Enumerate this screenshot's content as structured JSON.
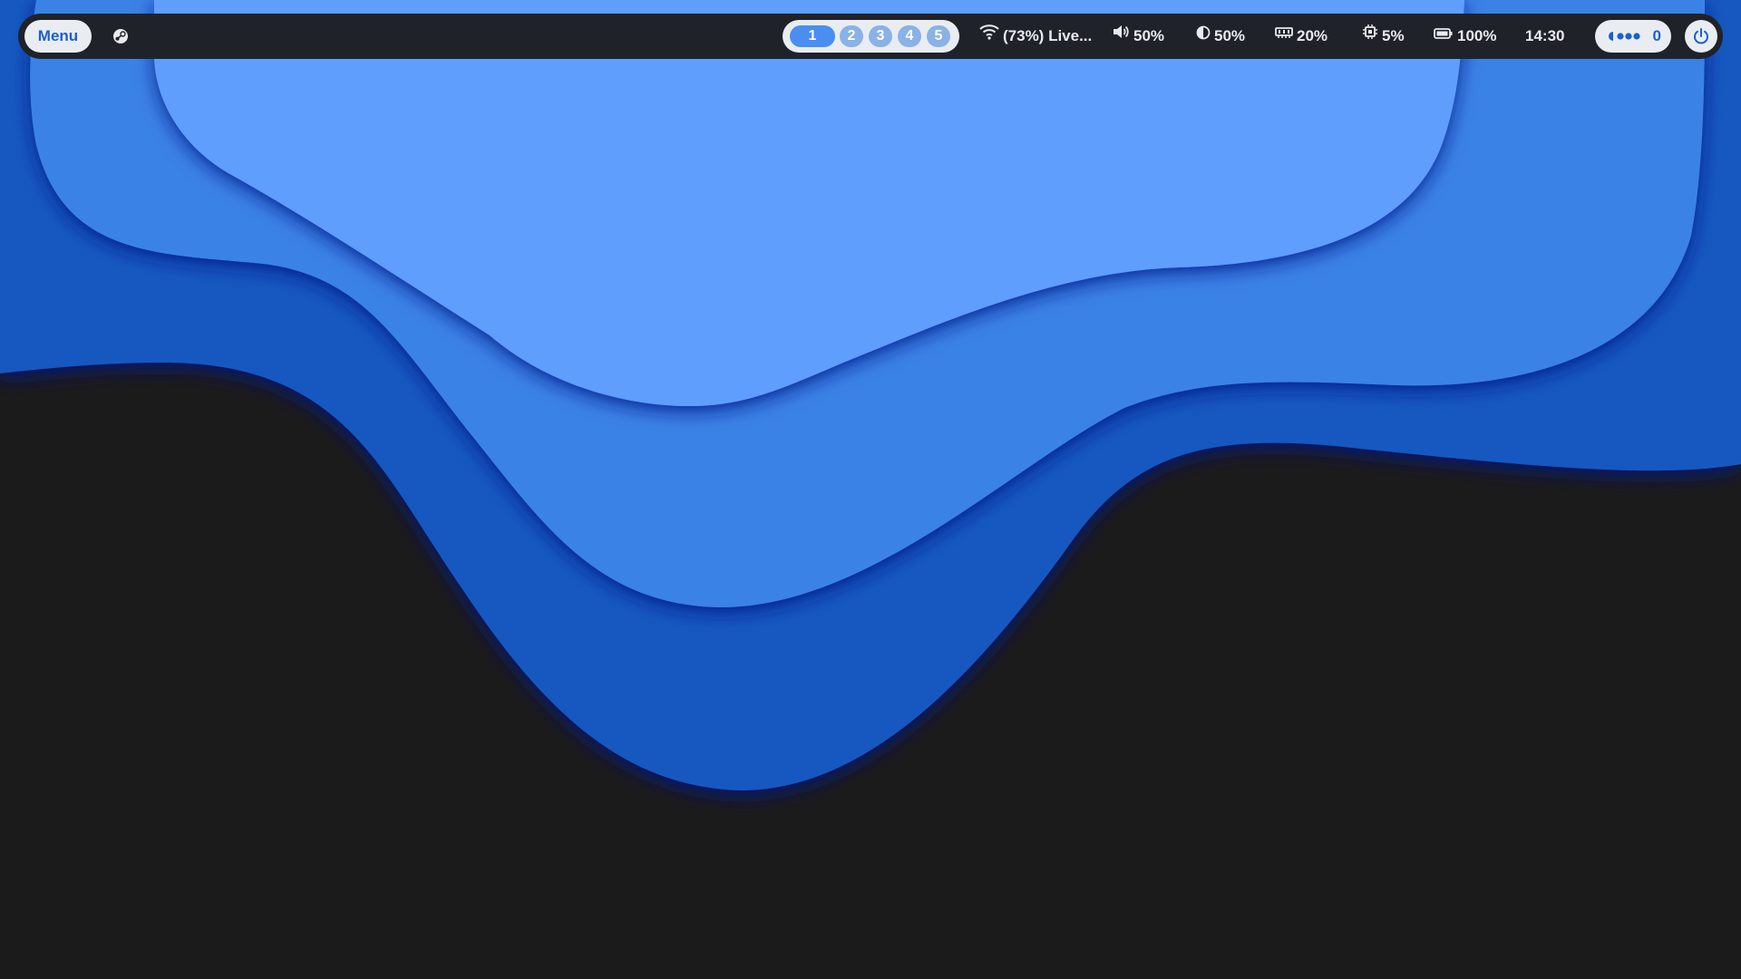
{
  "colors": {
    "bar_background": "#1f2329",
    "pill_background": "#e9edf2",
    "accent": "#1a5fd0",
    "workspace_active": "#4a8ef0",
    "workspace_idle": "#8ab2e6",
    "desktop_background": "#1b1b1b",
    "wave_light": "#5e9efd",
    "wave_mid": "#3b82e6",
    "wave_dark": "#1559c0"
  },
  "topbar": {
    "menu_label": "Menu",
    "steam_icon": "steam-icon",
    "workspaces": [
      {
        "label": "1",
        "active": true
      },
      {
        "label": "2",
        "active": false
      },
      {
        "label": "3",
        "active": false
      },
      {
        "label": "4",
        "active": false
      },
      {
        "label": "5",
        "active": false
      }
    ],
    "wifi": {
      "icon": "wifi-icon",
      "text": "(73%) Live..."
    },
    "volume": {
      "icon": "volume-icon",
      "text": "50%"
    },
    "brightness": {
      "icon": "brightness-icon",
      "text": "50%"
    },
    "memory": {
      "icon": "memory-icon",
      "text": "20%"
    },
    "cpu": {
      "icon": "cpu-icon",
      "text": "5%"
    },
    "battery": {
      "icon": "battery-icon",
      "text": "100%"
    },
    "clock": "14:30",
    "notifications": {
      "icon": "notification-dots-icon",
      "count": "0"
    },
    "power_icon": "power-icon"
  }
}
